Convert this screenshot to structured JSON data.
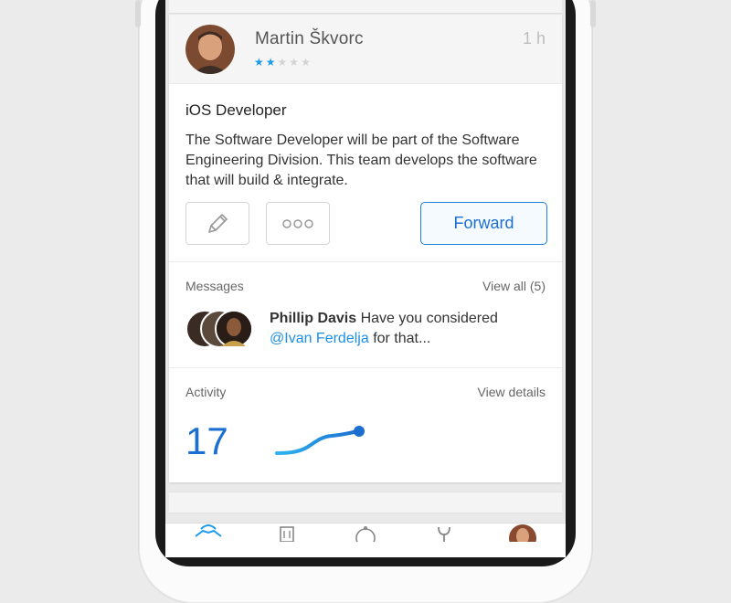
{
  "post": {
    "author": "Martin Škvorc",
    "time": "1 h",
    "rating": 2,
    "rating_max": 5,
    "title": "iOS Developer",
    "body": "The Software Developer will be part of the Software Engineering Division. This team develops the software that will build & integrate.",
    "actions": {
      "edit_icon": "pencil-icon",
      "more_icon": "more-dots-icon",
      "forward_label": "Forward"
    }
  },
  "messages": {
    "label": "Messages",
    "view_all": "View all (5)",
    "latest": {
      "sender": "Phillip Davis",
      "text_before": "Have you considered",
      "mention": "@Ivan Ferdelja",
      "text_after": "for that..."
    }
  },
  "activity": {
    "label": "Activity",
    "view_details": "View details",
    "count": "17"
  },
  "tabbar": {
    "tabs": [
      "handshake-icon",
      "building-icon",
      "compass-icon",
      "wrench-icon",
      "profile-avatar"
    ],
    "active": 0
  },
  "colors": {
    "accent": "#1a6fd0",
    "star_on": "#1e9be9",
    "star_off": "#d3d3d3",
    "mention": "#1e8ee6"
  }
}
